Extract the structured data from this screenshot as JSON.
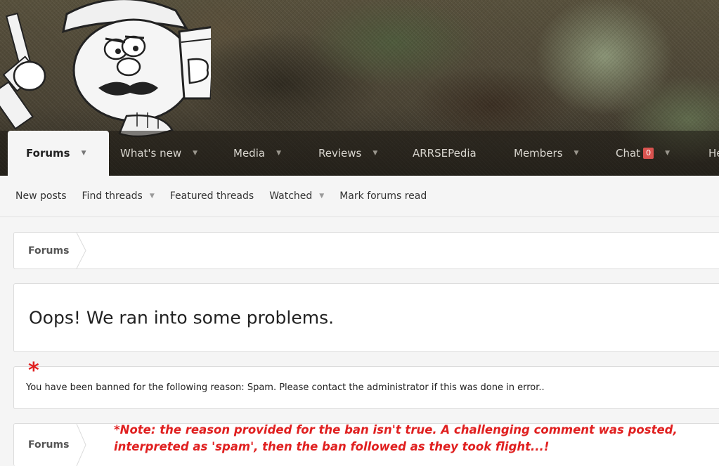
{
  "nav": {
    "tabs": [
      {
        "label": "Forums",
        "active": true,
        "has_menu": true
      },
      {
        "label": "What's new",
        "has_menu": true
      },
      {
        "label": "Media",
        "has_menu": true
      },
      {
        "label": "Reviews",
        "has_menu": true
      },
      {
        "label": "ARRSEPedia",
        "has_menu": false
      },
      {
        "label": "Members",
        "has_menu": true
      },
      {
        "label": "Chat",
        "badge": "0",
        "has_menu": true
      },
      {
        "label": "He",
        "has_menu": false
      }
    ]
  },
  "subnav": {
    "items": [
      {
        "label": "New posts"
      },
      {
        "label": "Find threads",
        "has_menu": true
      },
      {
        "label": "Featured threads"
      },
      {
        "label": "Watched",
        "has_menu": true
      },
      {
        "label": "Mark forums read"
      }
    ]
  },
  "breadcrumb_top": {
    "label": "Forums"
  },
  "error": {
    "title": "Oops! We ran into some problems.",
    "message": "You have been banned for the following reason: Spam. Please contact the administrator if this was done in error.."
  },
  "breadcrumb_bottom": {
    "label": "Forums"
  },
  "annotation": {
    "asterisk": "*",
    "note_line1": "*Note: the reason provided for the ban isn't true. A challenging comment was posted,",
    "note_line2": "interpreted as 'spam', then the ban followed as they took flight...!"
  },
  "colors": {
    "annotation_red": "#e02020",
    "badge_red": "#d9534f",
    "page_bg": "#f5f5f5"
  },
  "icons": [
    "mascot-cartoon",
    "chevron-down-icon",
    "breadcrumb-arrow-icon"
  ]
}
